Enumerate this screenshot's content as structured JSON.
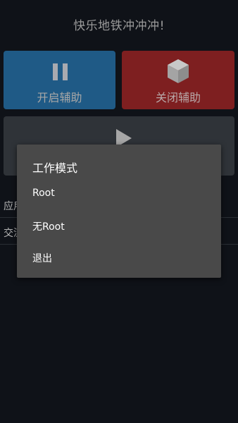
{
  "app": {
    "title": "快乐地铁冲冲冲!"
  },
  "tiles": {
    "start_label": "开启辅助",
    "stop_label": "关闭辅助"
  },
  "list": {
    "row1_label": "应用",
    "row2_label": "交流"
  },
  "dialog": {
    "title": "工作模式",
    "items": [
      "Root",
      "无Root",
      "退出"
    ]
  },
  "colors": {
    "background": "#0f1218",
    "start_tile": "#1f5a86",
    "stop_tile": "#7e1f20",
    "play_tile": "#2f3338",
    "dialog_bg": "#494949"
  },
  "icons": {
    "start": "pause-icon",
    "stop": "cube-icon",
    "play": "play-icon"
  }
}
